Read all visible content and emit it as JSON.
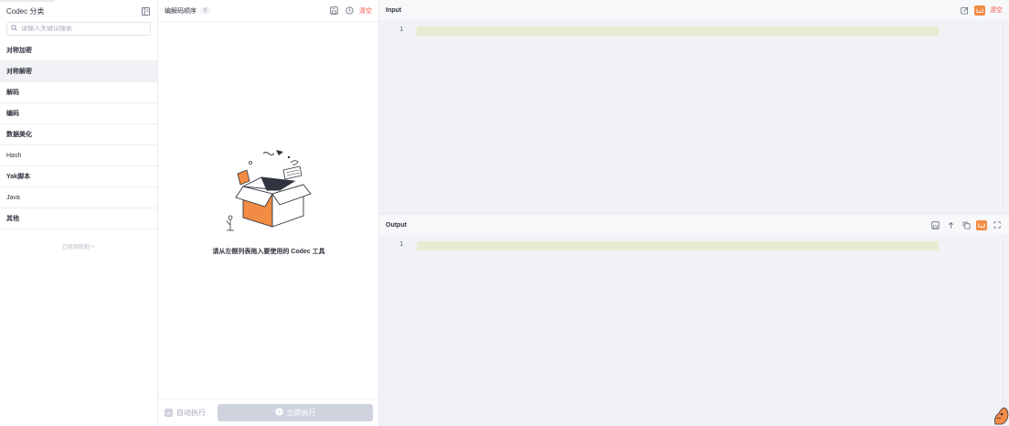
{
  "sidebar": {
    "title": "Codec 分类",
    "search_placeholder": "请输入关键词搜索",
    "categories": [
      {
        "label": "对称加密"
      },
      {
        "label": "对称解密"
      },
      {
        "label": "解码"
      },
      {
        "label": "编码"
      },
      {
        "label": "数据美化"
      },
      {
        "label": "Hash"
      },
      {
        "label": "Yak脚本"
      },
      {
        "label": "Java"
      },
      {
        "label": "其他"
      }
    ],
    "end_text": "已经到底啦～"
  },
  "middle": {
    "title": "编解码顺序",
    "count": "0",
    "clear_label": "清空",
    "empty_text": "请从左侧列表拖入要使用的 Codec 工具",
    "auto_run_label": "自动执行",
    "run_label": "立即执行"
  },
  "input": {
    "title": "Input",
    "clear_label": "清空",
    "line_number": "1"
  },
  "output": {
    "title": "Output",
    "line_number": "1"
  },
  "colors": {
    "accent": "#f28b44",
    "danger": "#f6544a",
    "line_highlight": "#e5ecd2"
  }
}
